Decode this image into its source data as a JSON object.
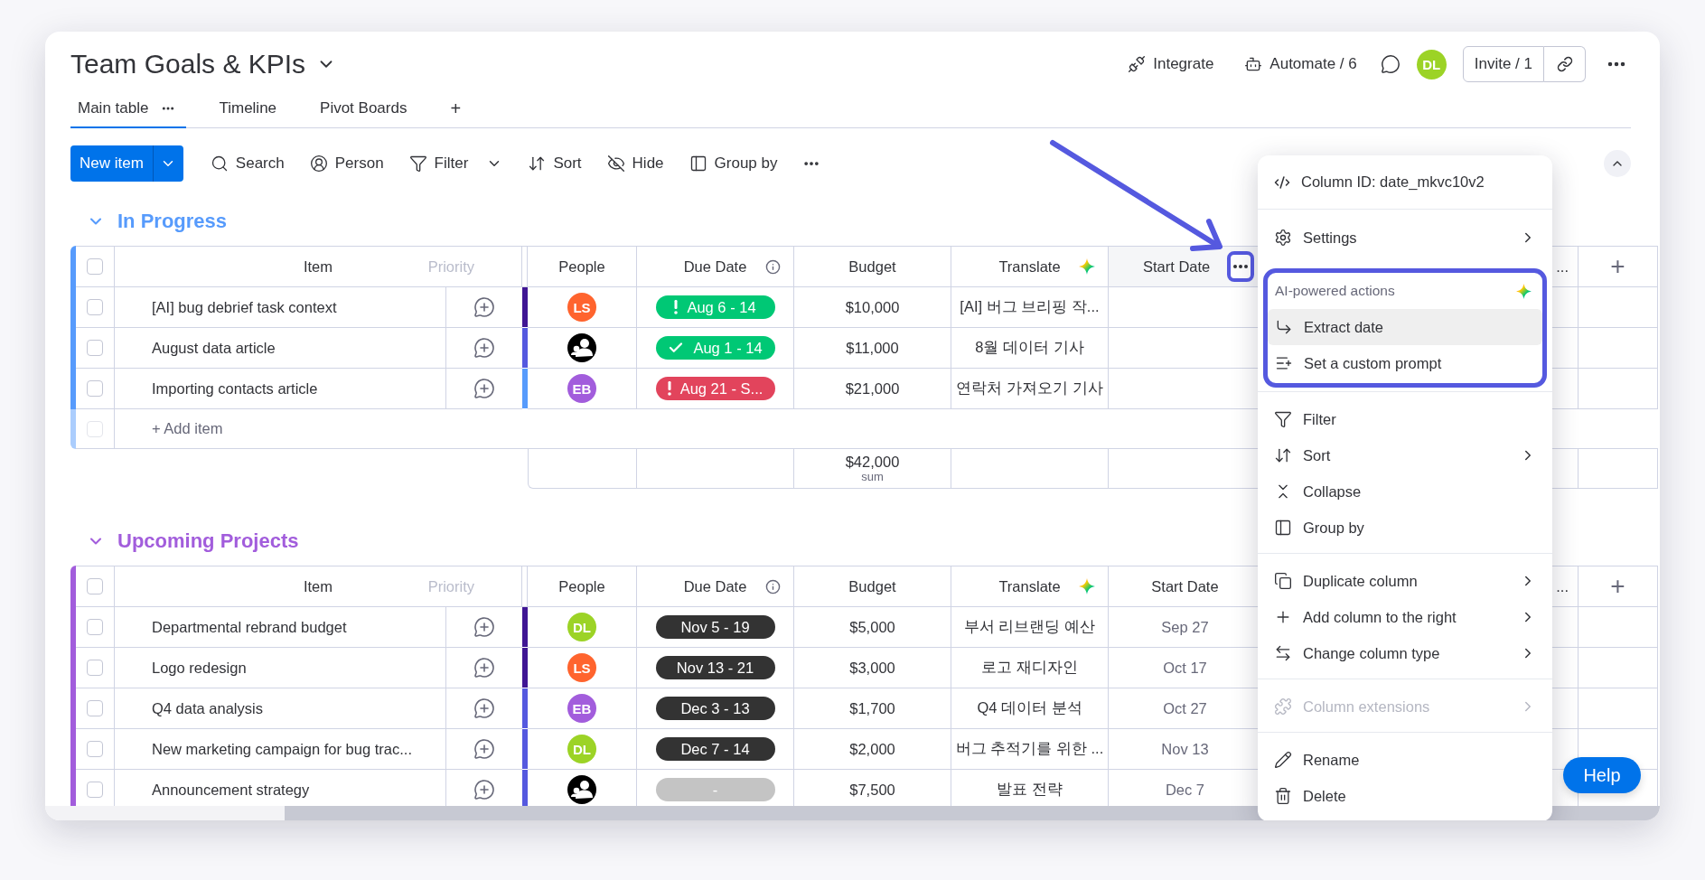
{
  "board": {
    "title": "Team Goals & KPIs"
  },
  "views": [
    {
      "label": "Main table",
      "selected": true
    },
    {
      "label": "Timeline",
      "selected": false
    },
    {
      "label": "Pivot Boards",
      "selected": false
    }
  ],
  "add_view": "+",
  "header_actions": {
    "integrate": "Integrate",
    "automate": "Automate / 6",
    "avatar": {
      "initials": "DL",
      "color": "#9cd326"
    },
    "invite": "Invite / 1"
  },
  "toolbar": {
    "new_item": "New item",
    "tools": [
      {
        "kind": "search",
        "label": "Search"
      },
      {
        "kind": "person",
        "label": "Person"
      },
      {
        "kind": "filter",
        "label": "Filter"
      },
      {
        "kind": "sort",
        "label": "Sort"
      },
      {
        "kind": "hide",
        "label": "Hide"
      },
      {
        "kind": "group",
        "label": "Group by"
      }
    ]
  },
  "groups": [
    {
      "title": "In Progress",
      "color": "#579bfc",
      "header": {
        "checked": false,
        "item": "Item",
        "ghost": "Priority",
        "people": "People",
        "due": "Due Date",
        "budget": "Budget",
        "translate": "Translate",
        "start": "Start Date",
        "menu_open": true,
        "next": "...",
        "add_column": "+"
      },
      "rows": [
        {
          "checked": false,
          "item": "[AI] bug debrief task context",
          "color": "#401694",
          "person": {
            "kind": "initials",
            "initials": "LS",
            "color": "#ff642e"
          },
          "due": {
            "kind": "alert",
            "text": "Aug 6 - 14",
            "color": "#00c875"
          },
          "budget": "$10,000",
          "translate": "[AI] 버그 브리핑 작..."
        },
        {
          "checked": false,
          "item": "August data article",
          "color": "#5559df",
          "person": {
            "kind": "generic"
          },
          "due": {
            "kind": "done",
            "text": "Aug 1 - 14",
            "color": "#00c875"
          },
          "budget": "$11,000",
          "translate": "8월 데이터 기사"
        },
        {
          "checked": false,
          "item": "Importing contacts article",
          "color": "#579bfc",
          "person": {
            "kind": "initials",
            "initials": "EB",
            "color": "#a25ddc"
          },
          "due": {
            "kind": "alert",
            "text": "Aug 21 - S...",
            "color": "#e2445c"
          },
          "budget": "$21,000",
          "translate": "연락처 가져오기 기사"
        }
      ],
      "add_item": {
        "label": "+ Add item",
        "checked": false
      },
      "sum": {
        "value": "$42,000",
        "label": "sum"
      }
    },
    {
      "title": "Upcoming Projects",
      "color": "#a25ddc",
      "header": {
        "checked": false,
        "item": "Item",
        "ghost": "Priority",
        "people": "People",
        "due": "Due Date",
        "budget": "Budget",
        "translate": "Translate",
        "start": "Start Date",
        "menu_open": false,
        "next": "...",
        "add_column": "+"
      },
      "rows": [
        {
          "checked": false,
          "item": "Departmental rebrand budget",
          "color": "#401694",
          "person": {
            "kind": "initials",
            "initials": "DL",
            "color": "#9cd326"
          },
          "due": {
            "kind": "plain",
            "text": "Nov 5 - 19",
            "color": "#333333"
          },
          "budget": "$5,000",
          "translate": "부서 리브랜딩 예산",
          "start": "Sep 27"
        },
        {
          "checked": false,
          "item": "Logo redesign",
          "color": "#401694",
          "person": {
            "kind": "initials",
            "initials": "LS",
            "color": "#ff642e"
          },
          "due": {
            "kind": "plain",
            "text": "Nov 13 - 21",
            "color": "#333333"
          },
          "budget": "$3,000",
          "translate": "로고 재디자인",
          "start": "Oct 17"
        },
        {
          "checked": false,
          "item": "Q4 data analysis",
          "color": "#5559df",
          "person": {
            "kind": "initials",
            "initials": "EB",
            "color": "#a25ddc"
          },
          "due": {
            "kind": "plain",
            "text": "Dec 3 - 13",
            "color": "#333333"
          },
          "budget": "$1,700",
          "translate": "Q4 데이터 분석",
          "start": "Oct 27"
        },
        {
          "checked": false,
          "item": "New marketing campaign for bug trac...",
          "color": "#5559df",
          "person": {
            "kind": "initials",
            "initials": "DL",
            "color": "#9cd326"
          },
          "due": {
            "kind": "plain",
            "text": "Dec 7 - 14",
            "color": "#333333"
          },
          "budget": "$2,000",
          "translate": "버그 추적기를 위한 ...",
          "start": "Nov 13"
        },
        {
          "checked": false,
          "item": "Announcement strategy",
          "color": "#5559df",
          "person": {
            "kind": "generic"
          },
          "due": {
            "kind": "empty",
            "text": "-",
            "color": "#c4c4c4"
          },
          "budget": "$7,500",
          "translate": "발표 전략",
          "start": "Dec 7"
        }
      ]
    }
  ],
  "column_menu": {
    "column_id": "Column ID: date_mkvc10v2",
    "sections": [
      {
        "kind": "plain",
        "items": [
          {
            "kind": "settings",
            "label": "Settings",
            "submenu": true,
            "disabled": false,
            "hovered": false
          }
        ]
      },
      {
        "kind": "ai",
        "title": "AI-powered actions",
        "highlighted": true,
        "items": [
          {
            "kind": "extract",
            "label": "Extract date",
            "submenu": false,
            "disabled": false,
            "hovered": true
          },
          {
            "kind": "prompt",
            "label": "Set a custom prompt",
            "submenu": false,
            "disabled": false,
            "hovered": false
          }
        ]
      },
      {
        "kind": "plain",
        "items": [
          {
            "kind": "filter",
            "label": "Filter",
            "submenu": false,
            "disabled": false,
            "hovered": false
          },
          {
            "kind": "sort",
            "label": "Sort",
            "submenu": true,
            "disabled": false,
            "hovered": false
          },
          {
            "kind": "collapse",
            "label": "Collapse",
            "submenu": false,
            "disabled": false,
            "hovered": false
          },
          {
            "kind": "group",
            "label": "Group by",
            "submenu": false,
            "disabled": false,
            "hovered": false
          }
        ]
      },
      {
        "kind": "plain",
        "items": [
          {
            "kind": "duplicate",
            "label": "Duplicate column",
            "submenu": true,
            "disabled": false,
            "hovered": false
          },
          {
            "kind": "add",
            "label": "Add column to the right",
            "submenu": true,
            "disabled": false,
            "hovered": false
          },
          {
            "kind": "change",
            "label": "Change column type",
            "submenu": true,
            "disabled": false,
            "hovered": false
          }
        ]
      },
      {
        "kind": "plain",
        "items": [
          {
            "kind": "extensions",
            "label": "Column extensions",
            "submenu": true,
            "disabled": true,
            "hovered": false
          }
        ]
      },
      {
        "kind": "plain",
        "items": [
          {
            "kind": "rename",
            "label": "Rename",
            "submenu": false,
            "disabled": false,
            "hovered": false
          },
          {
            "kind": "delete",
            "label": "Delete",
            "submenu": false,
            "disabled": false,
            "hovered": false
          }
        ]
      }
    ]
  },
  "help": "Help"
}
